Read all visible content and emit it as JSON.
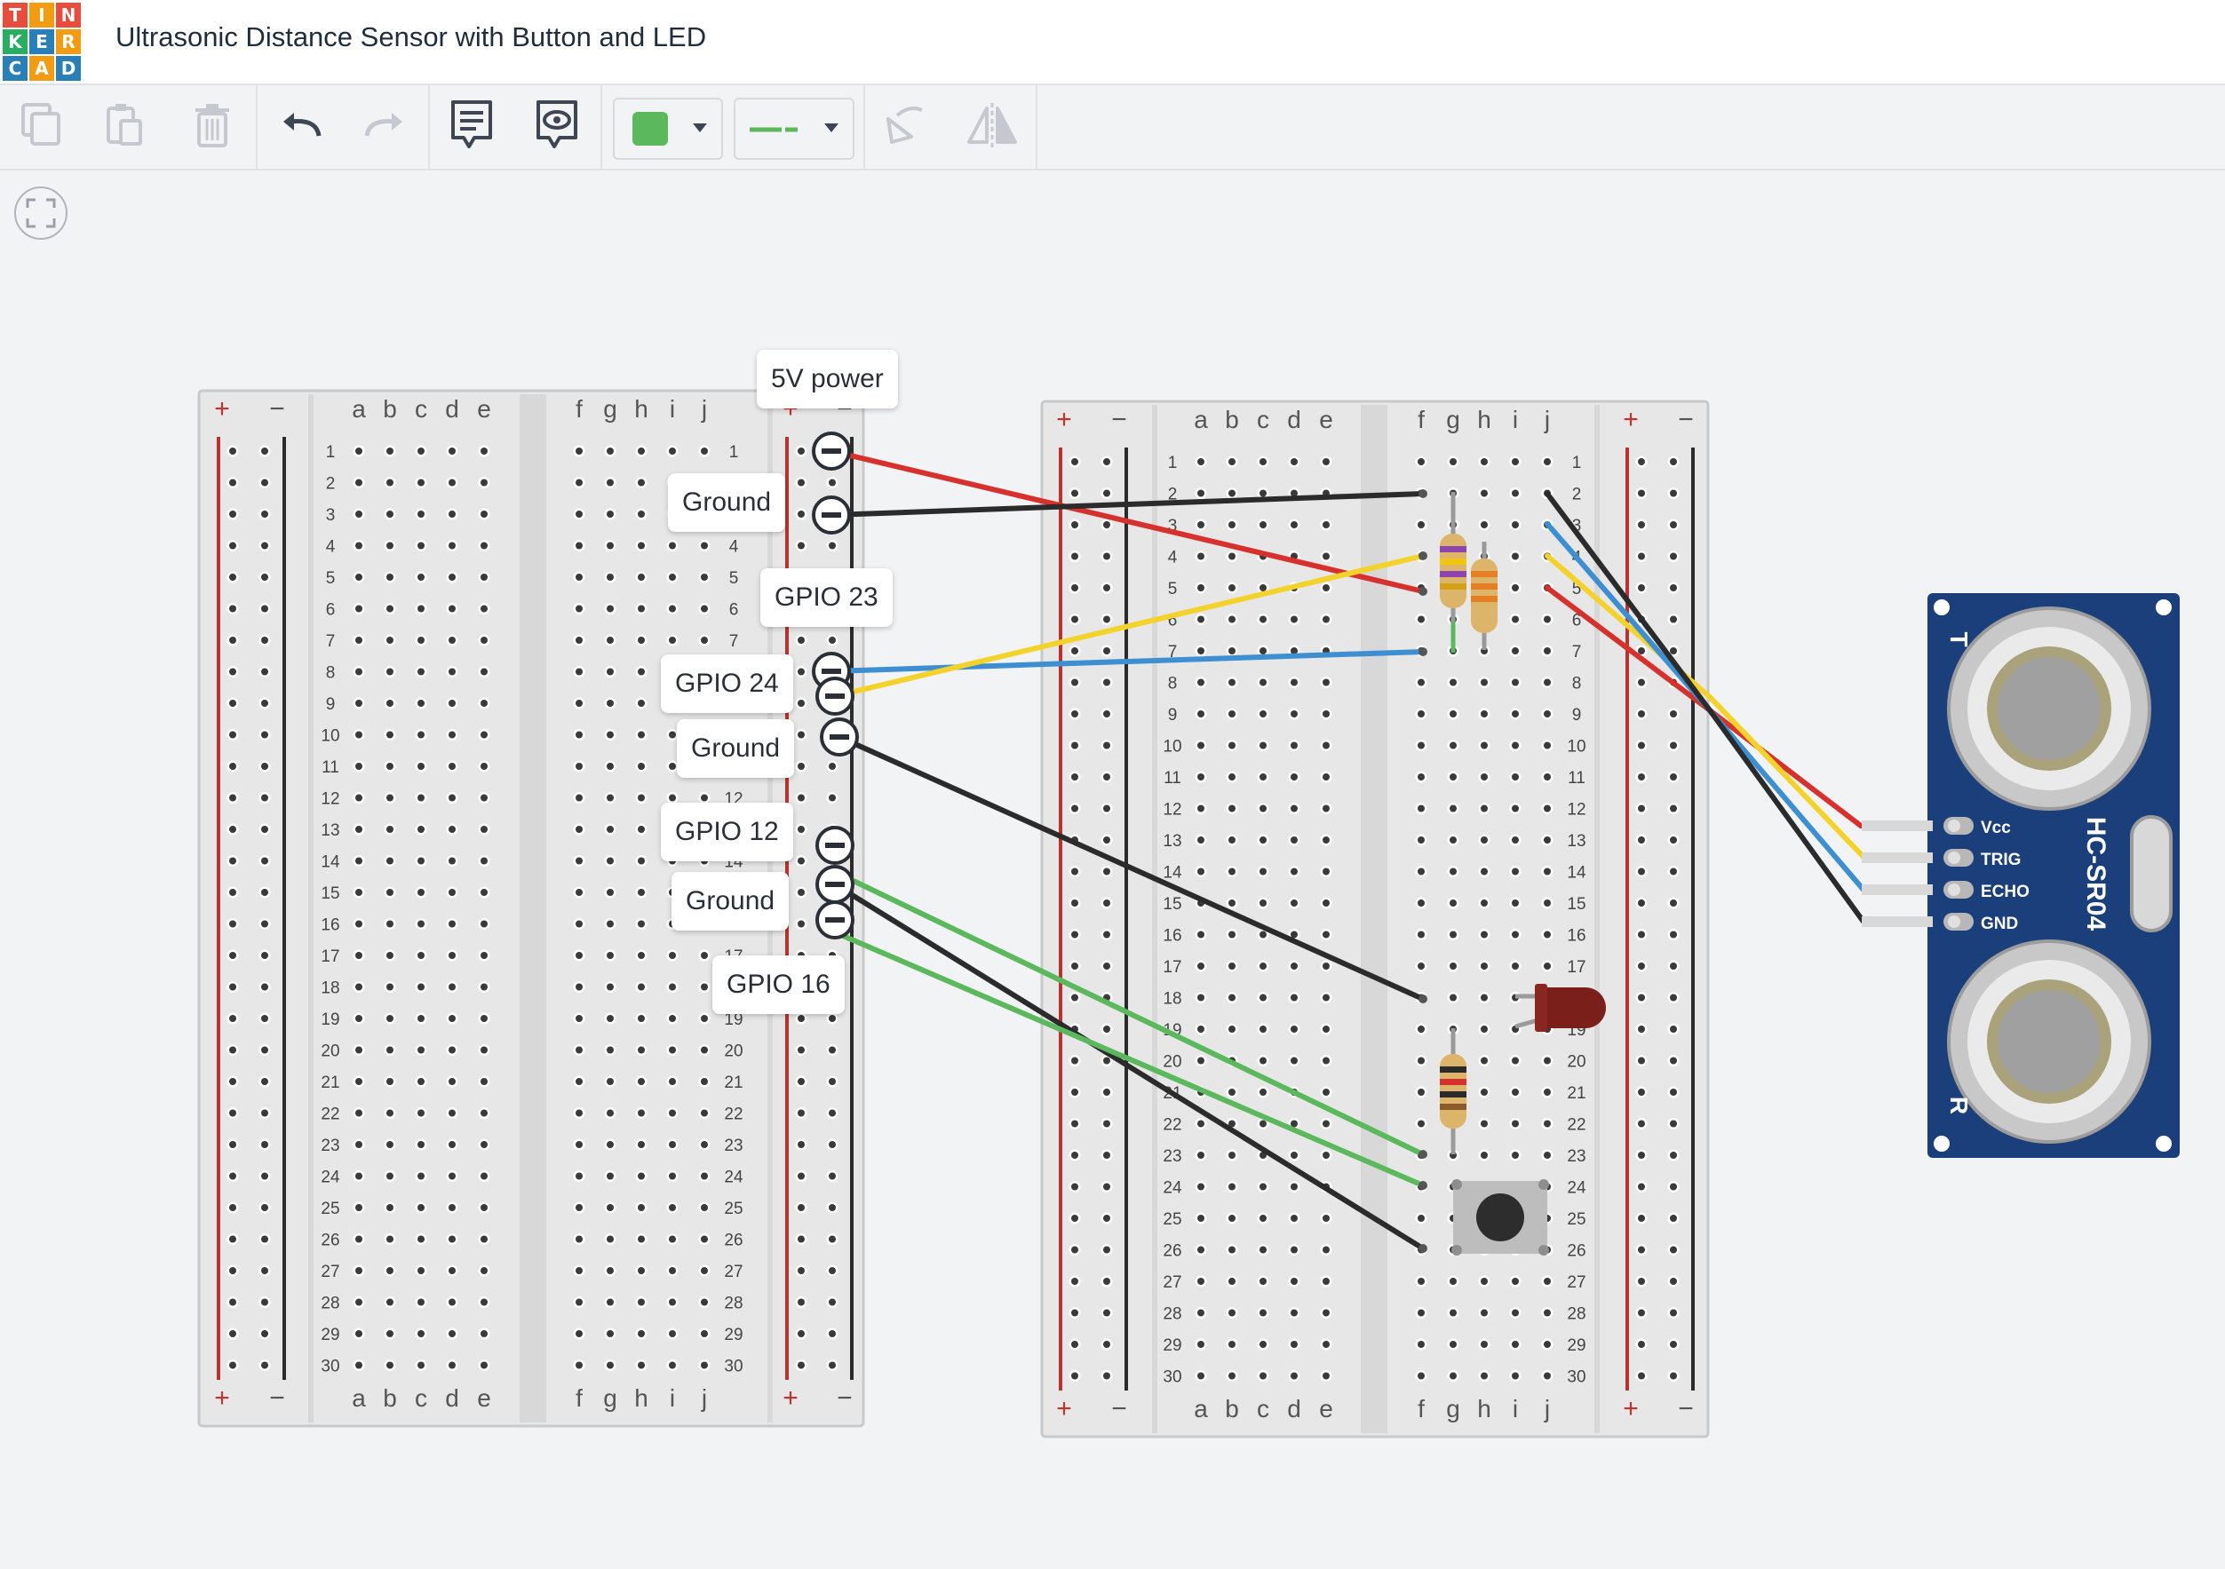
{
  "app": {
    "title": "Ultrasonic Distance Sensor with Button and LED",
    "logo_letters": [
      "T",
      "I",
      "N",
      "K",
      "E",
      "R",
      "C",
      "A",
      "D"
    ],
    "logo_colors": [
      "#e74c3c",
      "#f39c12",
      "#e74c3c",
      "#27ae60",
      "#2980b9",
      "#f39c12",
      "#2980b9",
      "#f39c12",
      "#2980b9"
    ]
  },
  "toolbar": {
    "items": [
      "copy-icon",
      "paste-icon",
      "delete-icon",
      "undo-icon",
      "redo-icon",
      "notes-icon",
      "notes-visibility-icon",
      "color-picker",
      "line-style-picker",
      "rotate-icon",
      "mirror-icon"
    ],
    "color_value": "#5bb85c",
    "line_color": "#5bb85c"
  },
  "breadboard": {
    "rows": [
      "1",
      "2",
      "3",
      "4",
      "5",
      "6",
      "7",
      "8",
      "9",
      "10",
      "11",
      "12",
      "13",
      "14",
      "15",
      "16",
      "17",
      "18",
      "19",
      "20",
      "21",
      "22",
      "23",
      "24",
      "25",
      "26",
      "27",
      "28",
      "29",
      "30"
    ],
    "cols_left": [
      "a",
      "b",
      "c",
      "d",
      "e"
    ],
    "cols_right": [
      "f",
      "g",
      "h",
      "i",
      "j"
    ],
    "plus": "+",
    "minus": "−"
  },
  "pin_labels": {
    "power": "5V power",
    "ground_1": "Ground",
    "gpio23": "GPIO 23",
    "gpio24": "GPIO 24",
    "ground_2": "Ground",
    "gpio12": "GPIO 12",
    "ground_3": "Ground",
    "gpio16": "GPIO 16"
  },
  "sensor": {
    "model": "HC-SR04",
    "pins": [
      "Vcc",
      "TRIG",
      "ECHO",
      "GND"
    ],
    "side_t": "T",
    "side_r": "R"
  },
  "wire_colors": {
    "red": "#d7312e",
    "black": "#2b2b2b",
    "blue": "#3d8fd1",
    "yellow": "#f4d22c",
    "green": "#5bb85c"
  }
}
